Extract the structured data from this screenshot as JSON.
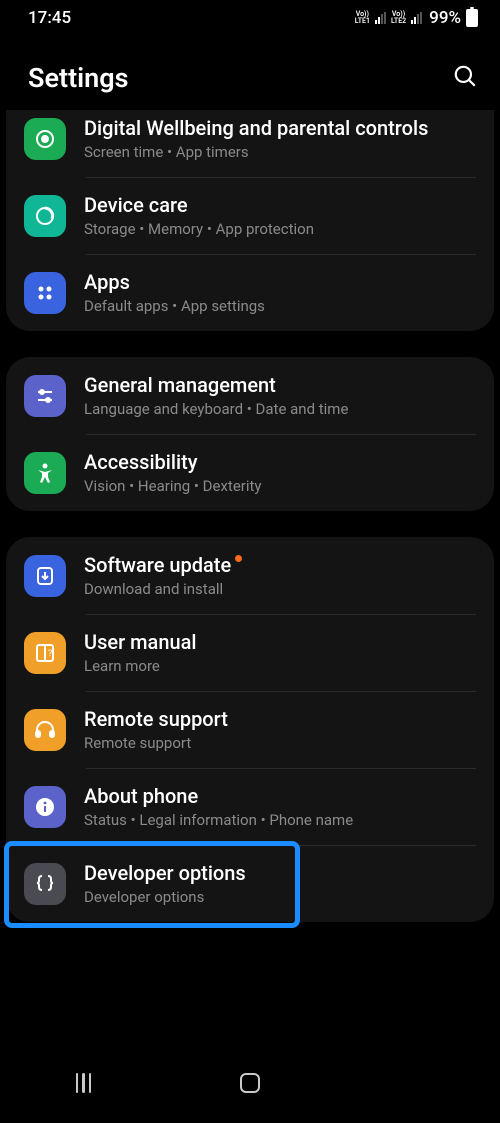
{
  "status": {
    "time": "17:45",
    "sim1": "Vo))\nLTE1",
    "sim2": "Vo))\nLTE2",
    "battery": "99%"
  },
  "header": {
    "title": "Settings"
  },
  "groups": [
    [
      {
        "icon": "wellbeing-icon",
        "bg": "bg-green",
        "title": "Digital Wellbeing and parental controls",
        "sub": "Screen time  •  App timers"
      },
      {
        "icon": "devicecare-icon",
        "bg": "bg-teal",
        "title": "Device care",
        "sub": "Storage  •  Memory  •  App protection"
      },
      {
        "icon": "apps-icon",
        "bg": "bg-blue",
        "title": "Apps",
        "sub": "Default apps  •  App settings"
      }
    ],
    [
      {
        "icon": "sliders-icon",
        "bg": "bg-indigo",
        "title": "General management",
        "sub": "Language and keyboard  •  Date and time"
      },
      {
        "icon": "accessibility-icon",
        "bg": "bg-green2",
        "title": "Accessibility",
        "sub": "Vision  •  Hearing  •  Dexterity"
      }
    ],
    [
      {
        "icon": "update-icon",
        "bg": "bg-blue2",
        "title": "Software update",
        "sub": "Download and install",
        "badge": true
      },
      {
        "icon": "manual-icon",
        "bg": "bg-amber",
        "title": "User manual",
        "sub": "Learn more"
      },
      {
        "icon": "headset-icon",
        "bg": "bg-amber2",
        "title": "Remote support",
        "sub": "Remote support"
      },
      {
        "icon": "info-icon",
        "bg": "bg-indigo",
        "title": "About phone",
        "sub": "Status  •  Legal information  •  Phone name"
      },
      {
        "icon": "braces-icon",
        "bg": "bg-grey",
        "title": "Developer options",
        "sub": "Developer options",
        "highlighted": true
      }
    ]
  ]
}
